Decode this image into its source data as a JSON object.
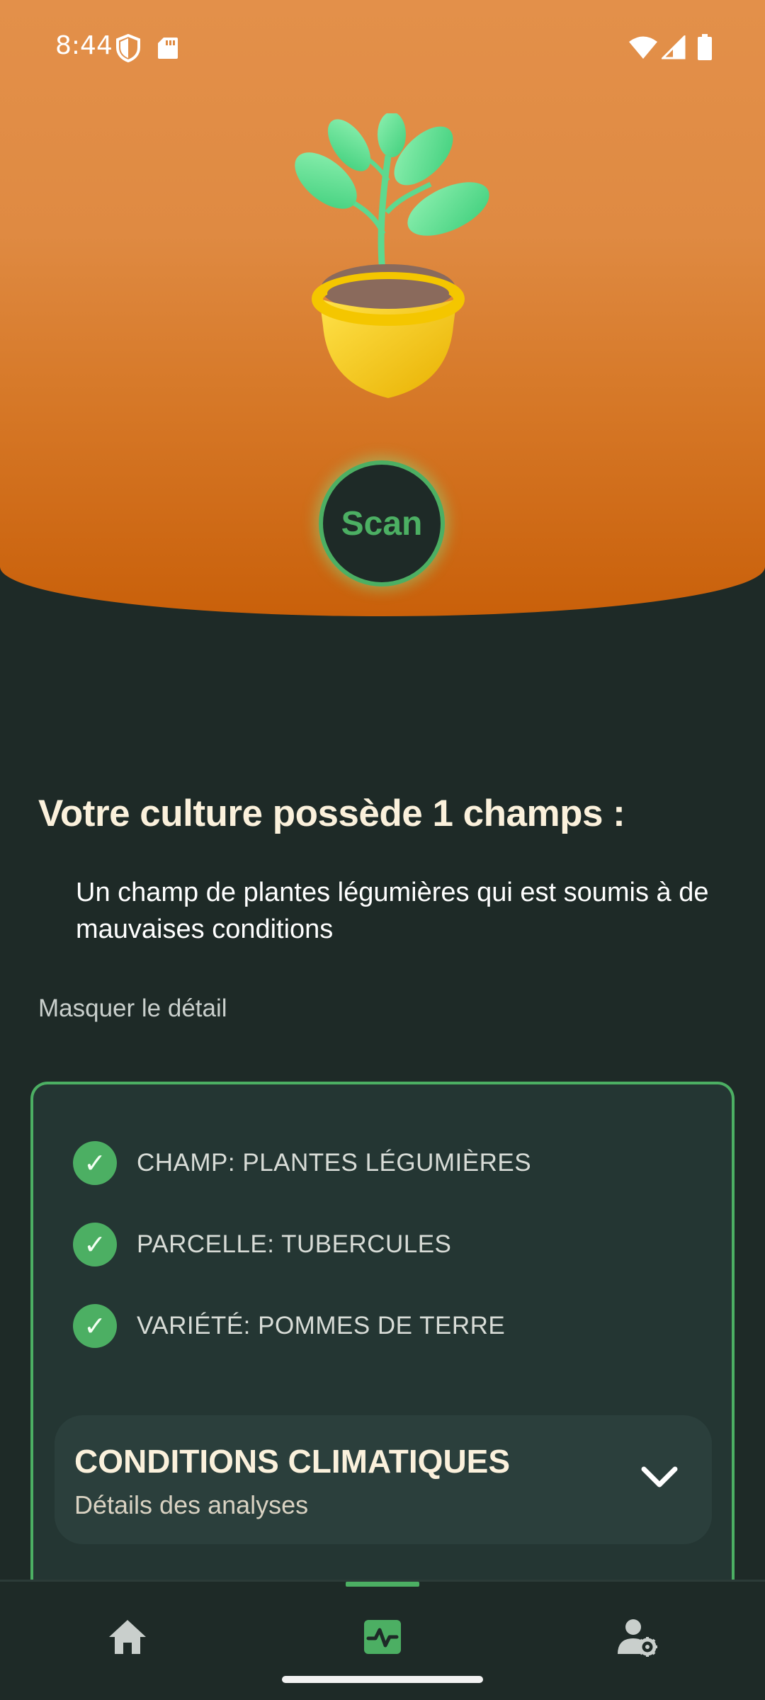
{
  "status_bar": {
    "time": "8:44",
    "icons": [
      "shield-icon",
      "sd-card-icon",
      "wifi-icon",
      "signal-icon",
      "battery-icon"
    ]
  },
  "hero": {
    "illustration": "potted-plant-icon",
    "scan_label": "Scan",
    "colors": {
      "top": "#e3904a",
      "bottom": "#c9600a",
      "accent": "#4caf63"
    }
  },
  "summary": {
    "headline": "Votre culture possède 1 champs :",
    "description": "Un champ de plantes légumières qui est soumis à de mauvaises conditions",
    "toggle_label": "Masquer le détail"
  },
  "details": {
    "items": [
      {
        "label": "CHAMP: PLANTES LÉGUMIÈRES",
        "icon": "check-circle-icon"
      },
      {
        "label": "PARCELLE: TUBERCULES",
        "icon": "check-circle-icon"
      },
      {
        "label": "VARIÉTÉ: POMMES DE TERRE",
        "icon": "check-circle-icon"
      }
    ],
    "accordion": {
      "title": "CONDITIONS CLIMATIQUES",
      "subtitle": "Détails des analyses",
      "icon": "chevron-down-icon"
    }
  },
  "bottom_nav": {
    "items": [
      {
        "name": "home",
        "icon": "home-icon",
        "active": false
      },
      {
        "name": "analysis",
        "icon": "activity-icon",
        "active": true
      },
      {
        "name": "profile",
        "icon": "user-settings-icon",
        "active": false
      }
    ]
  }
}
